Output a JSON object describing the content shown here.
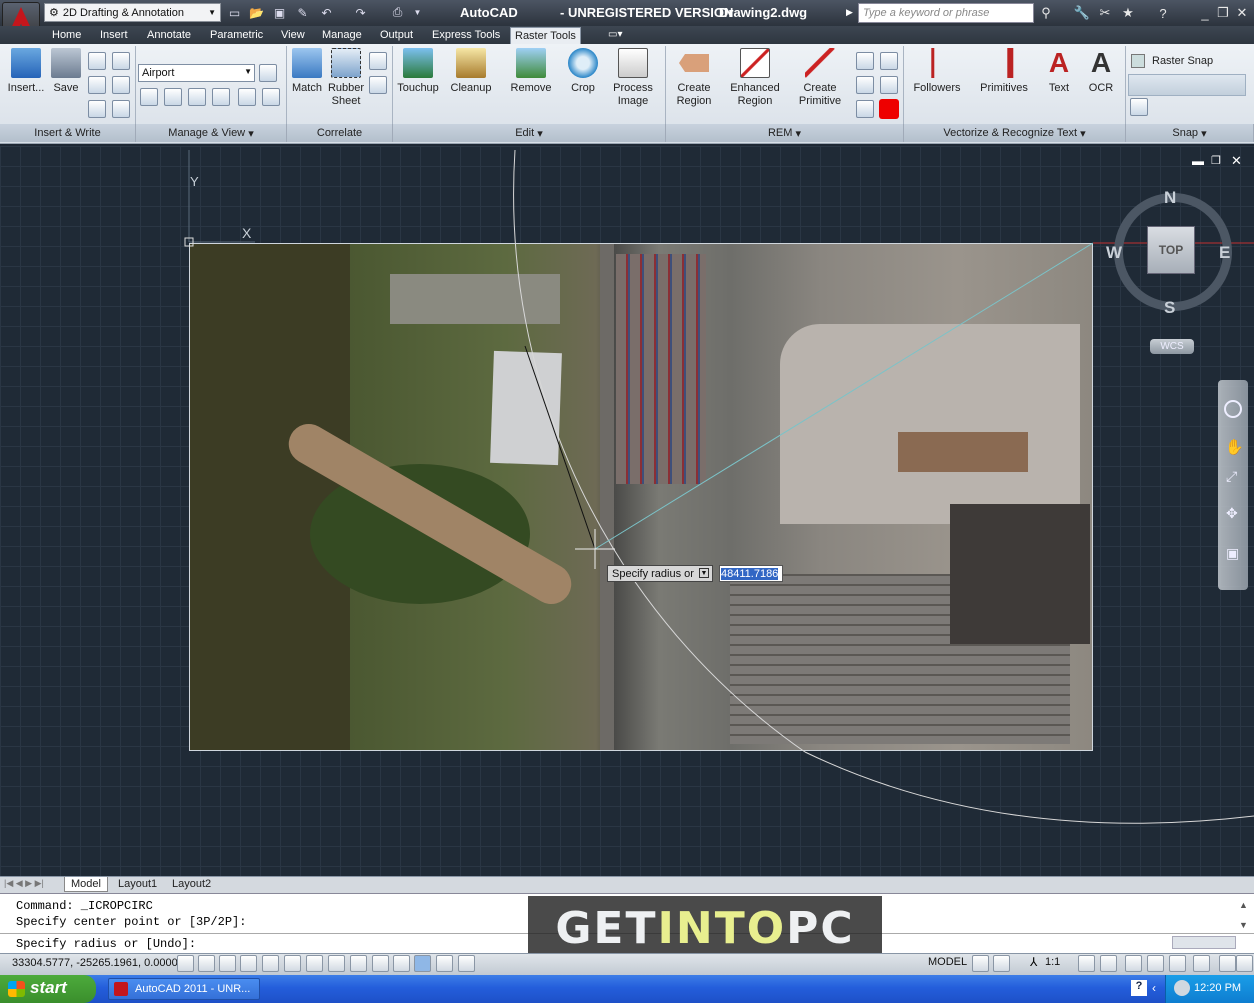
{
  "titlebar": {
    "workspace": "2D Drafting & Annotation",
    "app": "AutoCAD",
    "unregistered": "- UNREGISTERED VERSION",
    "document": "Drawing2.dwg",
    "search_placeholder": "Type a keyword or phrase"
  },
  "tabs": [
    "Home",
    "Insert",
    "Annotate",
    "Parametric",
    "View",
    "Manage",
    "Output",
    "Express Tools",
    "Raster Tools"
  ],
  "active_tab": "Raster Tools",
  "ribbon": {
    "insert_label": "Insert...",
    "save_label": "Save",
    "image_dropdown": "Airport",
    "match_label": "Match",
    "rubbersheet_label1": "Rubber",
    "rubbersheet_label2": "Sheet",
    "touchup_label": "Touchup",
    "cleanup_label": "Cleanup",
    "remove_label": "Remove",
    "crop_label": "Crop",
    "process_label1": "Process",
    "process_label2": "Image",
    "createregion_label1": "Create",
    "createregion_label2": "Region",
    "enhanced_label1": "Enhanced",
    "enhanced_label2": "Region",
    "createprim_label1": "Create",
    "createprim_label2": "Primitive",
    "followers_label": "Followers",
    "primitives_label": "Primitives",
    "text_label": "Text",
    "ocr_label": "OCR",
    "rastersnap_label": "Raster Snap",
    "panels": {
      "insert_write": "Insert & Write",
      "manage_view": "Manage & View",
      "correlate": "Correlate",
      "edit": "Edit",
      "rem": "REM",
      "vectorize": "Vectorize & Recognize Text",
      "snap": "Snap"
    }
  },
  "viewcube": {
    "north": "N",
    "south": "S",
    "east": "E",
    "west": "W",
    "face": "TOP",
    "wcs": "WCS"
  },
  "ucs": {
    "y": "Y",
    "x": "X"
  },
  "prompt": {
    "label": "Specify radius or",
    "value": "48411.7186"
  },
  "layout_tabs": [
    "Model",
    "Layout1",
    "Layout2"
  ],
  "command_lines": [
    "Command:  _ICROPCIRC",
    "Specify center point or [3P/2P]:",
    "Specify radius or [Undo]:"
  ],
  "watermark": {
    "part1": "GET ",
    "part2": "INTO",
    "part3": " PC"
  },
  "status": {
    "coords": "33304.5777, -25265.1961, 0.0000",
    "model": "MODEL",
    "scale": "1:1"
  },
  "taskbar": {
    "start": "start",
    "item": "AutoCAD 2011 - UNR...",
    "clock": "12:20 PM"
  }
}
